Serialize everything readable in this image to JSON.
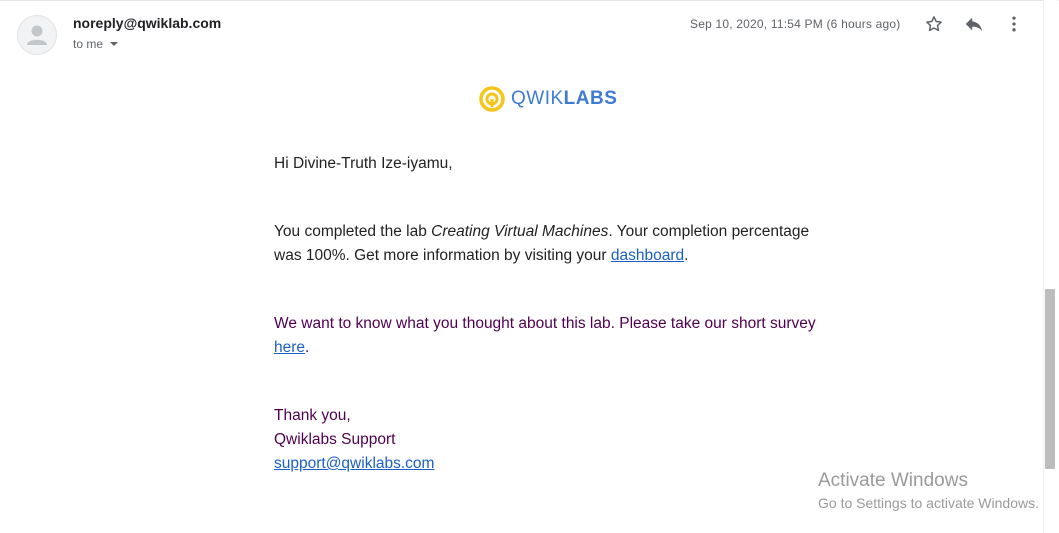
{
  "header": {
    "sender": "noreply@qwiklab.com",
    "recipient_label": "to me",
    "timestamp": "Sep 10, 2020, 11:54 PM (6 hours ago)",
    "icons": [
      "person-avatar-icon",
      "star-icon",
      "reply-icon",
      "more-vert-icon",
      "chevron-down-icon"
    ]
  },
  "logo": {
    "text_light": "QWIK",
    "text_bold": "LABS",
    "accent_color": "#f5c518",
    "brand_color": "#3d7bd5"
  },
  "message": {
    "greeting": "Hi Divine-Truth Ize-iyamu,",
    "para1_start": "You completed the lab ",
    "lab_name": "Creating Virtual Machines",
    "para1_mid": ". Your completion percentage was 100%. Get more information by visiting your ",
    "dashboard_link": "dashboard",
    "para1_end": ".",
    "para2_start": "We want to know what you thought about this lab. Please take our short survey ",
    "survey_link": "here",
    "para2_end": ".",
    "signoff": "Thank you,",
    "team": "Qwiklabs Support",
    "support_email": "support@qwiklabs.com",
    "quoted_color": "#500050",
    "link_color": "#1a5fc8"
  },
  "watermark": {
    "line1": "Activate Windows",
    "line2": "Go to Settings to activate Windows."
  }
}
